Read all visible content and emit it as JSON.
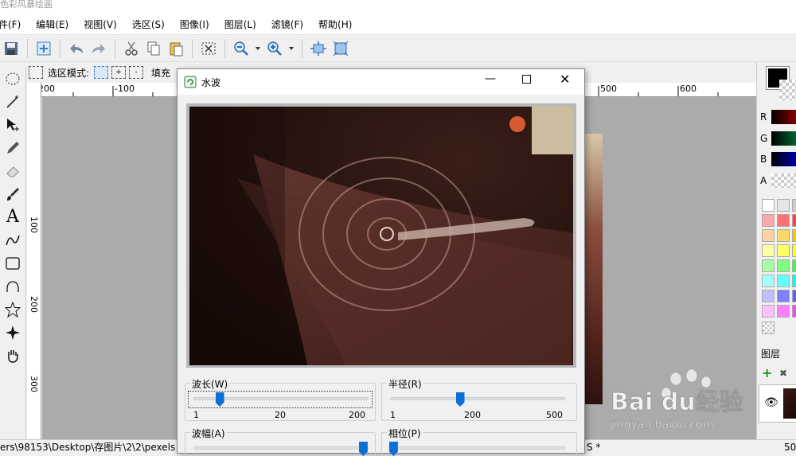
{
  "app": {
    "title": "色彩风暴绘画"
  },
  "menu": [
    "件(F)",
    "编辑(E)",
    "视图(V)",
    "选区(S)",
    "图像(I)",
    "图层(L)",
    "滤镜(F)",
    "帮助(H)"
  ],
  "toolbar2": {
    "select_mode_label": "选区模式:",
    "fill_label": "填充"
  },
  "ruler": {
    "h": [
      "-200",
      "-100",
      "500",
      "600"
    ],
    "v": [
      "100",
      "200",
      "300"
    ]
  },
  "status": {
    "path": "ers\\98153\\Desktop\\存图片\\2\\2\\pexels",
    "coord": "S *",
    "right": "50"
  },
  "right": {
    "channels": [
      "R",
      "G",
      "B",
      "A"
    ],
    "layers_label": "图层"
  },
  "dialog": {
    "title": "水波",
    "wavelength": {
      "label": "波长(W)",
      "min": "1",
      "mid": "20",
      "max": "200",
      "value_fraction": 0.15
    },
    "radius": {
      "label": "半径(R)",
      "min": "1",
      "mid": "200",
      "max": "500",
      "value_fraction": 0.4
    },
    "amplitude": {
      "label": "波幅(A)",
      "value_fraction": 0.97
    },
    "phase": {
      "label": "相位(P)",
      "value_fraction": 0.02
    }
  },
  "watermark": {
    "brand": "Bai du经验",
    "url": "jingyan.baidu.com"
  }
}
